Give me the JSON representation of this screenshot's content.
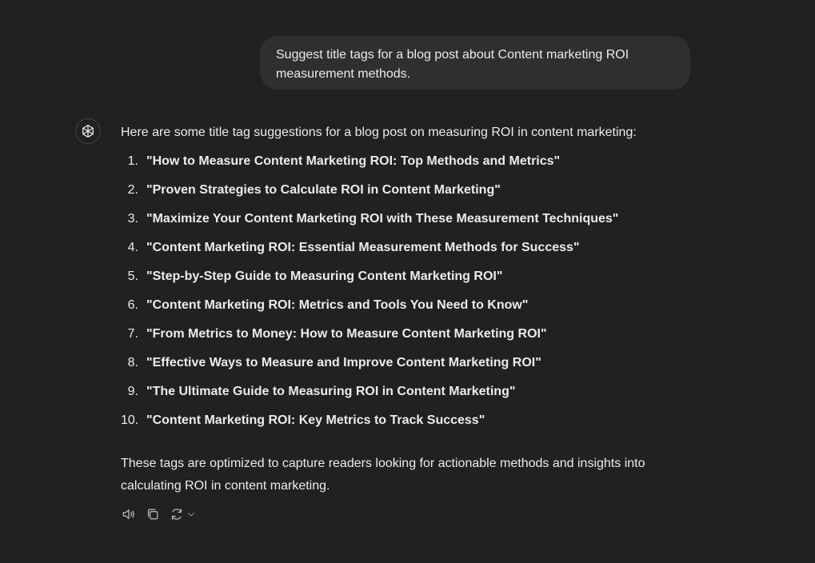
{
  "user_message": "Suggest title tags for a blog post about Content marketing ROI measurement methods.",
  "assistant": {
    "intro": "Here are some title tag suggestions for a blog post on measuring ROI in content marketing:",
    "titles": [
      {
        "num": "1.",
        "text": "\"How to Measure Content Marketing ROI: Top Methods and Metrics\""
      },
      {
        "num": "2.",
        "text": "\"Proven Strategies to Calculate ROI in Content Marketing\""
      },
      {
        "num": "3.",
        "text": "\"Maximize Your Content Marketing ROI with These Measurement Techniques\""
      },
      {
        "num": "4.",
        "text": "\"Content Marketing ROI: Essential Measurement Methods for Success\""
      },
      {
        "num": "5.",
        "text": "\"Step-by-Step Guide to Measuring Content Marketing ROI\""
      },
      {
        "num": "6.",
        "text": "\"Content Marketing ROI: Metrics and Tools You Need to Know\""
      },
      {
        "num": "7.",
        "text": "\"From Metrics to Money: How to Measure Content Marketing ROI\""
      },
      {
        "num": "8.",
        "text": "\"Effective Ways to Measure and Improve Content Marketing ROI\""
      },
      {
        "num": "9.",
        "text": "\"The Ultimate Guide to Measuring ROI in Content Marketing\""
      },
      {
        "num": "10.",
        "text": "\"Content Marketing ROI: Key Metrics to Track Success\""
      }
    ],
    "outro": "These tags are optimized to capture readers looking for actionable methods and insights into calculating ROI in content marketing."
  },
  "icons": {
    "avatar": "assistant-logo-icon",
    "read_aloud": "speaker-icon",
    "copy": "copy-icon",
    "regenerate": "regenerate-icon",
    "more": "chevron-down-icon"
  },
  "colors": {
    "background": "#212121",
    "user_bubble": "#2f2f2f",
    "text": "#ececec",
    "icon": "#b4b4b4"
  }
}
